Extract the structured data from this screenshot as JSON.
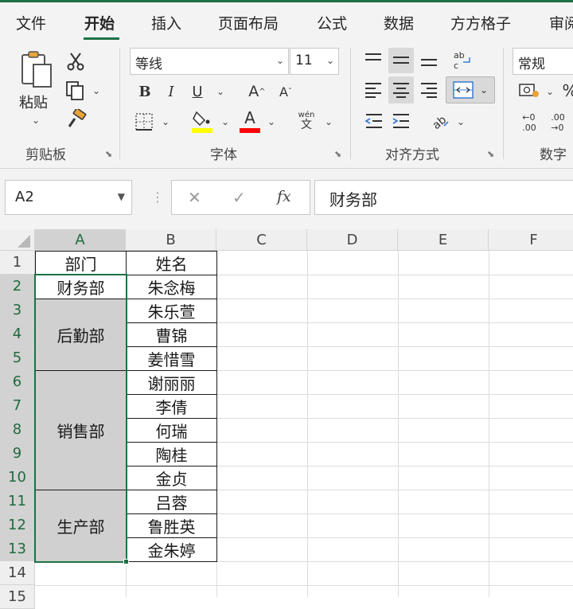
{
  "tabs": [
    "文件",
    "开始",
    "插入",
    "页面布局",
    "公式",
    "数据",
    "方方格子",
    "审阅"
  ],
  "clipboard": {
    "paste_label": "粘贴",
    "group_label": "剪贴板"
  },
  "font": {
    "name": "等线",
    "size": "11",
    "group_label": "字体",
    "bold": "B",
    "italic": "I",
    "underline": "U",
    "grow": "A",
    "shrink": "A",
    "font_color_glyph": "A",
    "phonetic_top": "wén",
    "phonetic_bottom": "文"
  },
  "alignment": {
    "group_label": "对齐方式"
  },
  "number": {
    "format": "常规",
    "group_label": "数字",
    "percent": "%",
    "inc_decimal": "←0\n.00",
    "dec_decimal": ".00\n→0"
  },
  "colors": {
    "accent": "#1e7145",
    "highlight_yellow": "#ffff00",
    "font_red": "#ff0000",
    "merged_fill": "#d0d0d0"
  },
  "formula_bar": {
    "name_box": "A2",
    "cancel": "✕",
    "enter": "✓",
    "fx": "fx",
    "content": "财务部"
  },
  "columns": [
    "A",
    "B",
    "C",
    "D",
    "E",
    "F"
  ],
  "rows": [
    "1",
    "2",
    "3",
    "4",
    "5",
    "6",
    "7",
    "8",
    "9",
    "10",
    "11",
    "12",
    "13",
    "14",
    "15"
  ],
  "cells": {
    "A1": "部门",
    "B1": "姓名",
    "A2": "财务部",
    "B2": "朱念梅",
    "A3": "后勤部",
    "B3": "朱乐萱",
    "B4": "曹锦",
    "B5": "姜惜雪",
    "A6": "销售部",
    "B6": "谢丽丽",
    "B7": "李倩",
    "B8": "何瑞",
    "B9": "陶桂",
    "B10": "金贞",
    "A11": "生产部",
    "B11": "吕蓉",
    "B12": "鲁胜英",
    "B13": "金朱婷"
  }
}
